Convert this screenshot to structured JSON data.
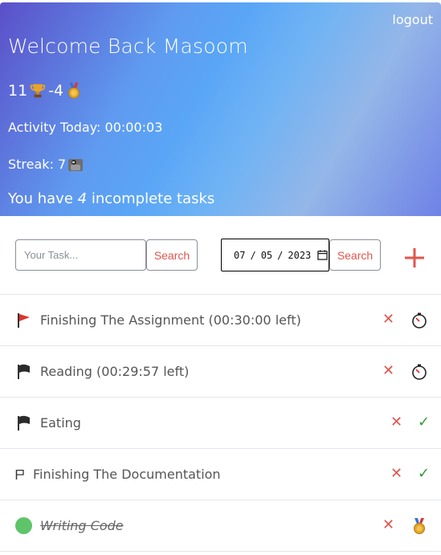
{
  "header": {
    "logout_label": "logout",
    "welcome": "Welcome Back Masoom",
    "trophies": "11",
    "medals_prefix": "-4",
    "activity": "Activity Today: 00:00:03",
    "streak": "Streak: 7",
    "incomplete_prefix": "You have ",
    "incomplete_count": "4",
    "incomplete_suffix": " incomplete tasks"
  },
  "toolbar": {
    "task_placeholder": "Your Task...",
    "search_label": "Search",
    "date_month": "07",
    "date_day": "05",
    "date_year": "2023",
    "search2_label": "Search"
  },
  "tasks": [
    {
      "label": "Finishing The Assignment (00:30:00 left)",
      "flag": "red-flag-icon",
      "action": "timer-icon"
    },
    {
      "label": "Reading (00:29:57 left)",
      "flag": "black-flag-icon",
      "action": "timer-icon"
    },
    {
      "label": "Eating",
      "flag": "black-flag-icon",
      "action": "check-icon"
    },
    {
      "label": "Finishing The Documentation",
      "flag": "small-flag-icon",
      "action": "check-icon"
    },
    {
      "label": "Writing Code",
      "flag": "completed-dot-icon",
      "action": "medal-icon"
    }
  ],
  "colors": {
    "accent": "#e2554d",
    "check": "#2e9c3a",
    "done_dot": "#5ec46a"
  }
}
